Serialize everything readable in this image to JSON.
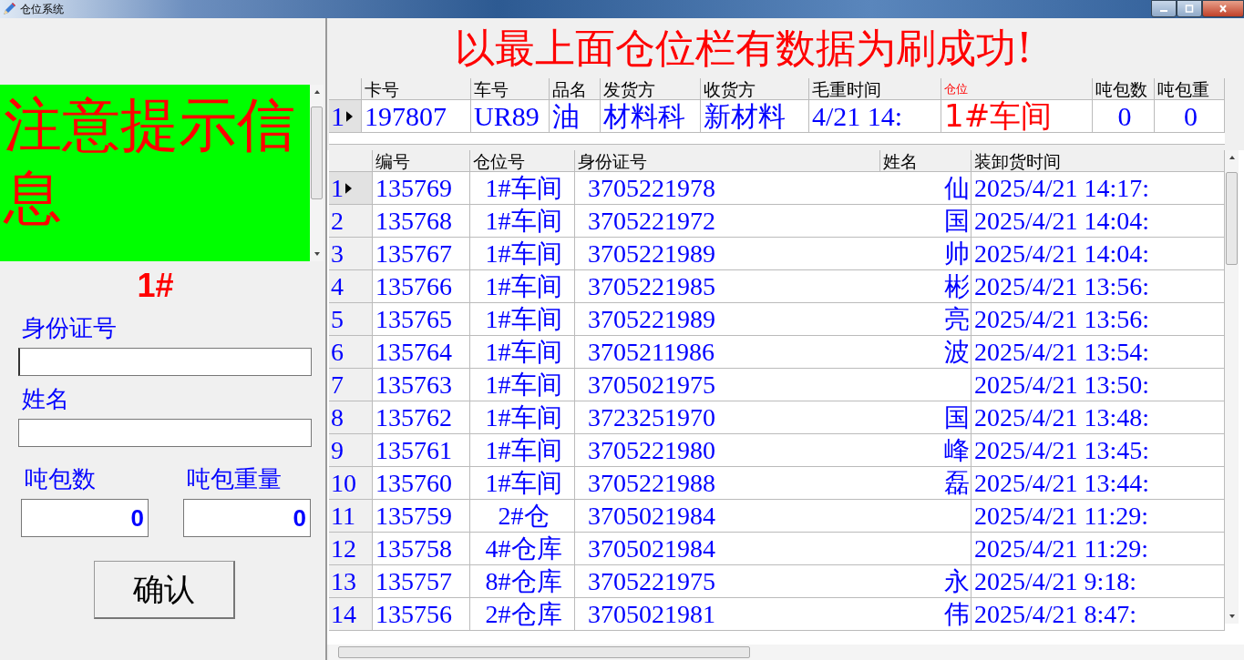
{
  "window": {
    "title": "仓位系统"
  },
  "notice": {
    "text": "注意提示信息",
    "station": "1#"
  },
  "form": {
    "id_label": "身份证号",
    "name_label": "姓名",
    "count_label": "吨包数",
    "count_value": "0",
    "weight_label": "吨包重量",
    "weight_value": "0",
    "confirm": "确认"
  },
  "banner": "以最上面仓位栏有数据为刷成功!",
  "top_table": {
    "columns": [
      "卡号",
      "车号",
      "品名",
      "发货方",
      "收货方",
      "毛重时间",
      "仓位",
      "吨包数",
      "吨包重"
    ],
    "rows": [
      {
        "index": "1",
        "selected": true,
        "cells": [
          "197807",
          "UR89",
          "油",
          "材料科",
          "新材料",
          "4/21 14:",
          "1#车间",
          "0",
          "0"
        ]
      }
    ]
  },
  "table": {
    "columns": [
      "编号",
      "仓位号",
      "身份证号",
      "姓名",
      "装卸货时间"
    ],
    "rows": [
      {
        "index": "1",
        "selected": true,
        "no": "135769",
        "bin": "1#车间",
        "id": "3705221978",
        "name": "仙",
        "time": "2025/4/21 14:17:"
      },
      {
        "index": "2",
        "selected": false,
        "no": "135768",
        "bin": "1#车间",
        "id": "3705221972",
        "name": "国",
        "time": "2025/4/21 14:04:"
      },
      {
        "index": "3",
        "selected": false,
        "no": "135767",
        "bin": "1#车间",
        "id": "3705221989",
        "name": "帅",
        "time": "2025/4/21 14:04:"
      },
      {
        "index": "4",
        "selected": false,
        "no": "135766",
        "bin": "1#车间",
        "id": "3705221985",
        "name": "彬",
        "time": "2025/4/21 13:56:"
      },
      {
        "index": "5",
        "selected": false,
        "no": "135765",
        "bin": "1#车间",
        "id": "3705221989",
        "name": "亮",
        "time": "2025/4/21 13:56:"
      },
      {
        "index": "6",
        "selected": false,
        "no": "135764",
        "bin": "1#车间",
        "id": "3705211986",
        "name": "波",
        "time": "2025/4/21 13:54:"
      },
      {
        "index": "7",
        "selected": false,
        "no": "135763",
        "bin": "1#车间",
        "id": "3705021975",
        "time": "2025/4/21 13:50:"
      },
      {
        "index": "8",
        "selected": false,
        "no": "135762",
        "bin": "1#车间",
        "id": "3723251970",
        "name": "国",
        "time": "2025/4/21 13:48:"
      },
      {
        "index": "9",
        "selected": false,
        "no": "135761",
        "bin": "1#车间",
        "id": "3705221980",
        "name": "峰",
        "time": "2025/4/21 13:45:"
      },
      {
        "index": "10",
        "selected": false,
        "no": "135760",
        "bin": "1#车间",
        "id": "3705221988",
        "name": "磊",
        "time": "2025/4/21 13:44:"
      },
      {
        "index": "11",
        "selected": false,
        "no": "135759",
        "bin": "2#仓",
        "id": "3705021984",
        "time": "2025/4/21 11:29:"
      },
      {
        "index": "12",
        "selected": false,
        "no": "135758",
        "bin": "4#仓库",
        "id": "3705021984",
        "time": "2025/4/21 11:29:"
      },
      {
        "index": "13",
        "selected": false,
        "no": "135757",
        "bin": "8#仓库",
        "id": "3705221975",
        "name": "永",
        "time": "2025/4/21 9:18:"
      },
      {
        "index": "14",
        "selected": false,
        "no": "135756",
        "bin": "2#仓库",
        "id": "3705021981",
        "name": "伟",
        "time": "2025/4/21 8:47:"
      }
    ]
  }
}
